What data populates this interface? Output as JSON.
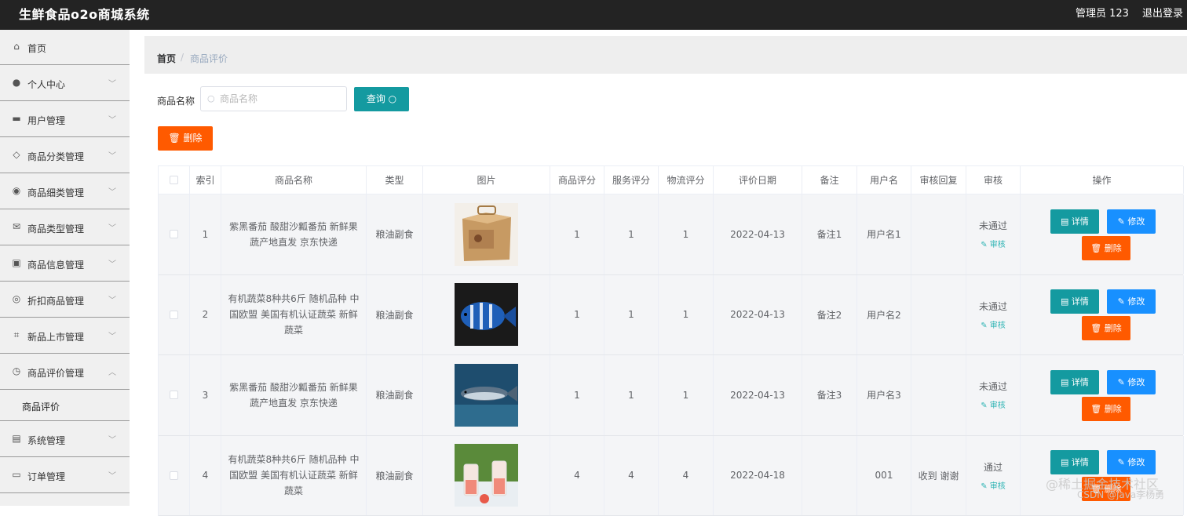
{
  "header": {
    "title": "生鲜食品o2o商城系统",
    "admin": "管理员 123",
    "logout": "退出登录"
  },
  "sidebar": {
    "items": [
      {
        "label": "首页",
        "icon": "home-icon",
        "glyph": "⌂"
      },
      {
        "label": "个人中心",
        "icon": "user-icon",
        "glyph": "●"
      },
      {
        "label": "用户管理",
        "icon": "briefcase-icon",
        "glyph": "▬"
      },
      {
        "label": "商品分类管理",
        "icon": "tag-icon",
        "glyph": "◇"
      },
      {
        "label": "商品细类管理",
        "icon": "compass-icon",
        "glyph": "◉"
      },
      {
        "label": "商品类型管理",
        "icon": "mail-icon",
        "glyph": "✉"
      },
      {
        "label": "商品信息管理",
        "icon": "clipboard-icon",
        "glyph": "▣"
      },
      {
        "label": "折扣商品管理",
        "icon": "circle-icon",
        "glyph": "◎"
      },
      {
        "label": "新品上市管理",
        "icon": "crop-icon",
        "glyph": "⌗"
      },
      {
        "label": "商品评价管理",
        "icon": "clock-icon",
        "glyph": "◷"
      },
      {
        "label": "系统管理",
        "icon": "doc-icon",
        "glyph": "▤"
      },
      {
        "label": "订单管理",
        "icon": "monitor-icon",
        "glyph": "▭"
      }
    ],
    "submenu_label": "商品评价"
  },
  "breadcrumb": {
    "home": "首页",
    "separator": "/",
    "current": "商品评价"
  },
  "search": {
    "label": "商品名称",
    "placeholder": "商品名称",
    "value": "",
    "query_label": "查询 ○"
  },
  "toolbar": {
    "delete_label": "🗑 删除"
  },
  "table": {
    "headers": [
      "",
      "索引",
      "商品名称",
      "类型",
      "图片",
      "商品评分",
      "服务评分",
      "物流评分",
      "评价日期",
      "备注",
      "用户名",
      "审核回复",
      "审核",
      "操作"
    ],
    "rows": [
      {
        "index": "1",
        "name": "紫黑番茄 酸甜沙瓤番茄 新鲜果蔬产地直发 京东快递",
        "type": "粮油副食",
        "image": "box-image",
        "goods_score": "1",
        "service_score": "1",
        "logistics_score": "1",
        "date": "2022-04-13",
        "note": "备注1",
        "username": "用户名1",
        "reply": "",
        "status": "未通过",
        "audit_link": "✎ 审核"
      },
      {
        "index": "2",
        "name": "有机蔬菜8种共6斤 随机品种 中国欧盟 美国有机认证蔬菜 新鲜蔬菜",
        "type": "粮油副食",
        "image": "fish-image",
        "goods_score": "1",
        "service_score": "1",
        "logistics_score": "1",
        "date": "2022-04-13",
        "note": "备注2",
        "username": "用户名2",
        "reply": "",
        "status": "未通过",
        "audit_link": "✎ 审核"
      },
      {
        "index": "3",
        "name": "紫黑番茄 酸甜沙瓤番茄 新鲜果蔬产地直发 京东快递",
        "type": "粮油副食",
        "image": "fish2-image",
        "goods_score": "1",
        "service_score": "1",
        "logistics_score": "1",
        "date": "2022-04-13",
        "note": "备注3",
        "username": "用户名3",
        "reply": "",
        "status": "未通过",
        "audit_link": "✎ 审核"
      },
      {
        "index": "4",
        "name": "有机蔬菜8种共6斤 随机品种 中国欧盟 美国有机认证蔬菜 新鲜蔬菜",
        "type": "粮油副食",
        "image": "drinks-image",
        "goods_score": "4",
        "service_score": "4",
        "logistics_score": "4",
        "date": "2022-04-18",
        "note": "",
        "username": "001",
        "reply": "收到 谢谢",
        "status": "通过",
        "audit_link": "✎ 审核"
      }
    ],
    "op_labels": {
      "detail": "▤ 详情",
      "edit": "✎ 修改",
      "delete": "🗑 删除"
    }
  },
  "watermark": {
    "line1": "@稀土掘金技术社区",
    "line2": "CSDN @java李杨勇"
  },
  "colors": {
    "topbar": "#232323",
    "teal": "#149aa0",
    "blue": "#1890ff",
    "orange": "#ff5a00"
  }
}
